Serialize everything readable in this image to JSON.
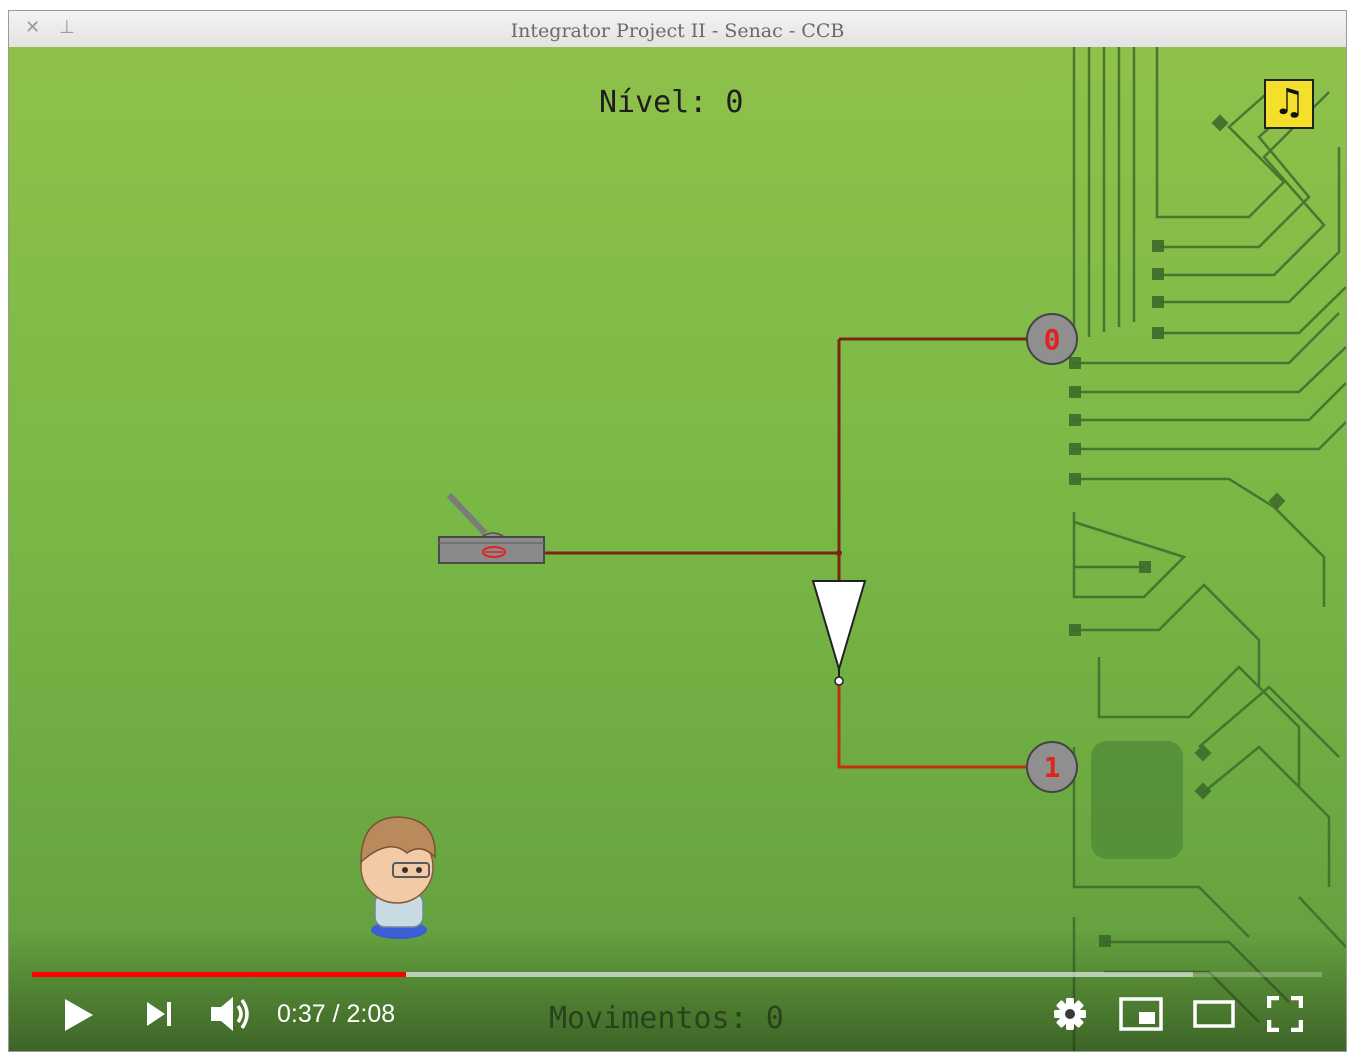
{
  "window": {
    "title": "Integrator Project II - Senac - CCB"
  },
  "game": {
    "level_text": "Nível: 0",
    "moves_text": "Movimentos: 0",
    "lamp_top_label": "0",
    "lamp_bottom_label": "1",
    "music_icon": "♫"
  },
  "player": {
    "current_time": "0:37",
    "separator": "/",
    "duration": "2:08",
    "played_fraction": 0.29,
    "buffered_fraction": 0.9
  },
  "icons": [
    "close-icon",
    "pin-icon",
    "music-note-icon",
    "play-icon",
    "skip-next-icon",
    "volume-icon",
    "settings-icon",
    "miniplayer-icon",
    "theater-icon",
    "fullscreen-icon"
  ],
  "colors": {
    "wire": "#7a2512",
    "wire_active": "#c43010",
    "background": "#7ab846",
    "progress": "#ff0000",
    "music_button": "#f4df2a"
  }
}
